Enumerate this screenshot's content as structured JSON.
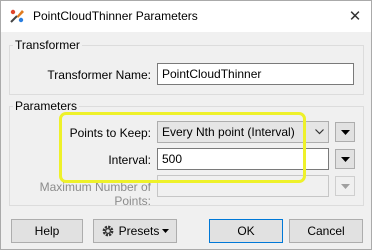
{
  "window": {
    "title": "PointCloudThinner Parameters",
    "close_glyph": "✕",
    "icon": "fme-app-icon"
  },
  "transformer_group": {
    "label": "Transformer",
    "name_label": "Transformer Name:",
    "name_value": "PointCloudThinner"
  },
  "parameters_group": {
    "label": "Parameters",
    "points_to_keep_label": "Points to Keep:",
    "points_to_keep_value": "Every Nth point (Interval)",
    "interval_label": "Interval:",
    "interval_value": "500",
    "max_points_label": "Maximum Number of Points:",
    "max_points_value": ""
  },
  "footer": {
    "help_label": "Help",
    "presets_label": "Presets",
    "ok_label": "OK",
    "cancel_label": "Cancel"
  },
  "colors": {
    "highlight": "#eef12a",
    "dialog_background": "#f0f0f0",
    "control_border": "#adadad"
  }
}
